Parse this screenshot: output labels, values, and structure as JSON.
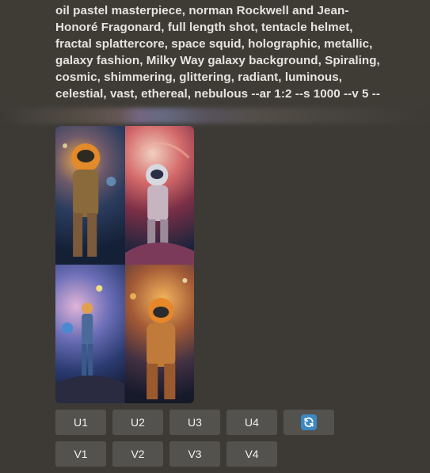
{
  "prompt": {
    "text": "oil pastel masterpiece, norman Rockwell and Jean-\nHonoré Fragonard, full length shot, tentacle helmet,\nfractal splattercore, space squid, holographic, metallic,\ngalaxy fashion, Milky Way galaxy background, Spiraling,\ncosmic, shimmering, glittering, radiant, luminous,\ncelestial, vast, ethereal, nebulous --ar 1:2 --s 1000 --v 5 --"
  },
  "upscale_buttons": [
    "U1",
    "U2",
    "U3",
    "U4"
  ],
  "variation_buttons": [
    "V1",
    "V2",
    "V3",
    "V4"
  ],
  "reroll": {
    "icon": "refresh-icon",
    "color": "#3b88c3"
  },
  "colors": {
    "background": "#3d3a35",
    "button": "#53524f",
    "text": "#e6e4df"
  }
}
